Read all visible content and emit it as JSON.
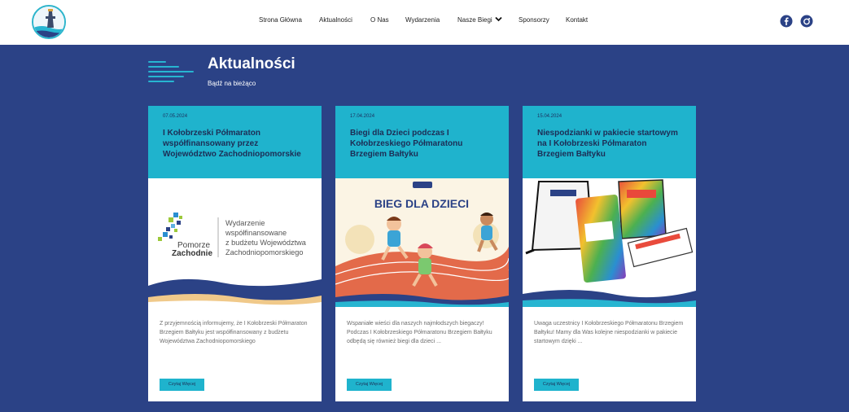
{
  "header": {
    "logo_icon": "race-tower-logo",
    "nav": [
      {
        "label": "Strona Główna"
      },
      {
        "label": "Aktualności"
      },
      {
        "label": "O Nas"
      },
      {
        "label": "Wydarzenia"
      },
      {
        "label": "Nasze Biegi"
      },
      {
        "label": "Sponsorzy"
      },
      {
        "label": "Kontakt"
      }
    ],
    "social": [
      "facebook-icon",
      "instagram-icon"
    ]
  },
  "page": {
    "title": "Aktualności",
    "subtitle": "Bądź na bieżąco"
  },
  "colors": {
    "background": "#2b4286",
    "accent": "#1fb3cd",
    "dark_text": "#1d2d55"
  },
  "cards": [
    {
      "date": "07.05.2024",
      "title": "I Kołobrzeski Półmaraton współfinansowany przez Województwo Zachodniopomorskie",
      "image": {
        "logo_text_1": "Pomorze",
        "logo_text_2": "Zachodnie",
        "caption_1": "Wydarzenie",
        "caption_2": "współfinansowane",
        "caption_3": "z budżetu Województwa",
        "caption_4": "Zachodniopomorskiego"
      },
      "excerpt": "Z przyjemnością informujemy, że I Kołobrzeski Półmaraton Brzegiem Bałtyku jest współfinansowany z budżetu Województwa Zachodniopomorskiego",
      "button": "Czytaj Więcej"
    },
    {
      "date": "17.04.2024",
      "title": "Biegi dla Dzieci podczas I Kołobrzeskiego Półmaratonu Brzegiem Bałtyku",
      "image": {
        "headline": "BIEG DLA DZIECI"
      },
      "excerpt": "Wspaniałe wieści dla naszych najmłodszych biegaczy! Podczas I Kołobrzeskiego Półmaratonu Brzegiem Bałtyku odbędą się również biegi dla dzieci ...",
      "button": "Czytaj Więcej"
    },
    {
      "date": "15.04.2024",
      "title": "Niespodzianki w pakiecie startowym na I Kołobrzeski Półmaraton Brzegiem Bałtyku",
      "image": {},
      "excerpt": "Uwaga uczestnicy I Kołobrzeskiego Półmaratonu Brzegiem Bałtyku! Mamy dla Was kolejne niespodzianki w pakiecie startowym dzięki ...",
      "button": "Czytaj Więcej"
    }
  ]
}
